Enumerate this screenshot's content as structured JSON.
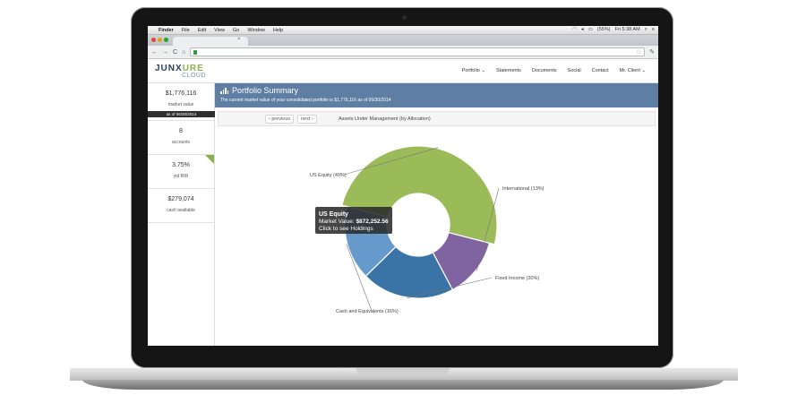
{
  "os_menubar": {
    "items": [
      "Finder",
      "File",
      "Edit",
      "View",
      "Go",
      "Window",
      "Help"
    ],
    "battery": "(55%)",
    "clock": "Fri 5:38 AM"
  },
  "brand": {
    "name_prefix": "JUNX",
    "name_accent": "URE",
    "sub": "CLOUD"
  },
  "nav": {
    "items": [
      "Portfolio ⌄",
      "Statements",
      "Documents",
      "Social",
      "Contact",
      "Mr. Client ⌄"
    ]
  },
  "sidebar": {
    "market_value": "$1,776,116",
    "market_value_label": "market value",
    "as_of": "as of 06/30/2014",
    "accounts": "8",
    "accounts_label": "accounts",
    "irr": "3.75%",
    "irr_label": "ytd IRR",
    "cash": "$279,074",
    "cash_label": "cash available"
  },
  "header": {
    "title": "Portfolio Summary",
    "subtitle": "The current market value of your consolidated portfolio is $1,776,116 as of 06/30/2014"
  },
  "pager": {
    "prev": "‹ previous",
    "next": "next ›",
    "caption": "Assets Under Management (by Allocation)"
  },
  "colors": {
    "us_equity": "#9bbb59",
    "international": "#8064a2",
    "fixed_income": "#3a73a5",
    "cash": "#6699cc",
    "header": "#5e7ea3"
  },
  "tooltip": {
    "title": "US Equity",
    "value_prefix": "Market Value: ",
    "value": "$872,252.56",
    "hint": "Click to see Holdings"
  },
  "chart_data": {
    "type": "pie",
    "categories": [
      "US Equity (49%)",
      "International (13%)",
      "Fixed Income (20%)",
      "Cash and Equivalents (16%)"
    ],
    "values": [
      49,
      13,
      20,
      16
    ]
  }
}
